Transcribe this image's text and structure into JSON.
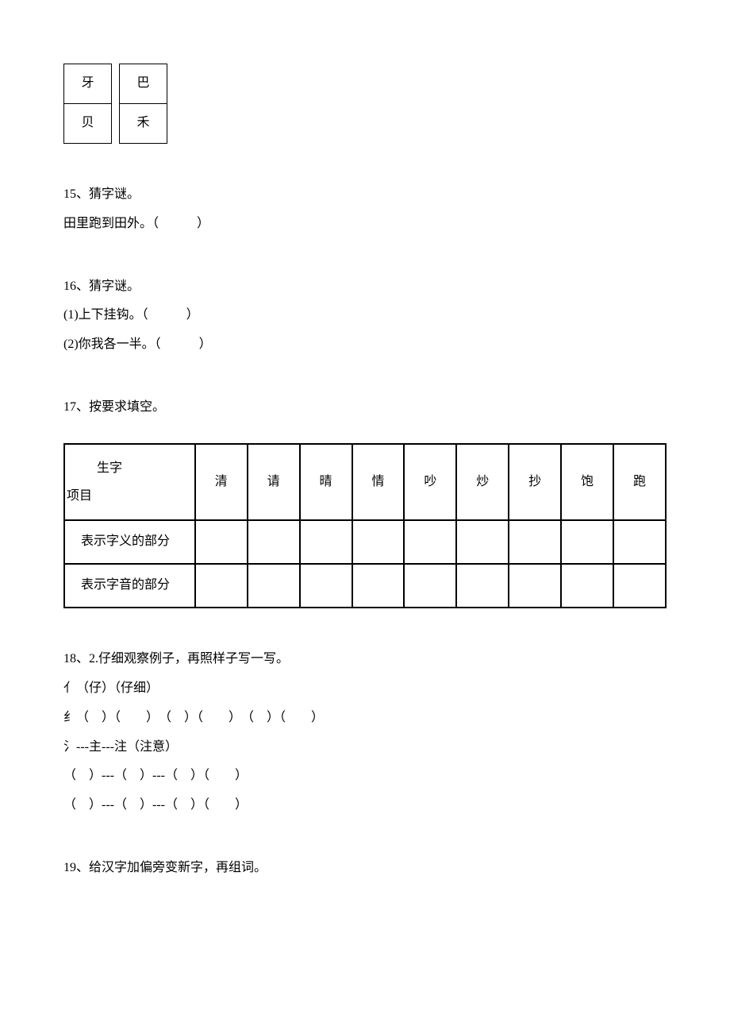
{
  "small_table": {
    "row1": {
      "col1": "牙",
      "col2": "巴"
    },
    "row2": {
      "col1": "贝",
      "col2": "禾"
    }
  },
  "q15": {
    "title": "15、猜字谜。",
    "line1": "田里跑到田外。（　　　）"
  },
  "q16": {
    "title": "16、猜字谜。",
    "line1": "(1)上下挂钩。（　　　）",
    "line2": "(2)你我各一半。（　　　）"
  },
  "q17": {
    "title": "17、按要求填空。",
    "table_header_top": "生字",
    "table_header_bottom": "项目",
    "chars": [
      "清",
      "请",
      "晴",
      "情",
      "吵",
      "炒",
      "抄",
      "饱",
      "跑"
    ],
    "row1_label": "表示字义的部分",
    "row2_label": "表示字音的部分"
  },
  "q18": {
    "title": "18、2.仔细观察例子，再照样子写一写。",
    "line1": "亻（仔）（仔细）",
    "line2": "纟（　）（　　）　（　）（　　）　（　）（　　）",
    "line3": "氵---主---注（注意）",
    "line4": "（　）---（　）---（　）（　　）",
    "line5": "（　）---（　）---（　）（　　）"
  },
  "q19": {
    "title": "19、给汉字加偏旁变新字，再组词。"
  }
}
